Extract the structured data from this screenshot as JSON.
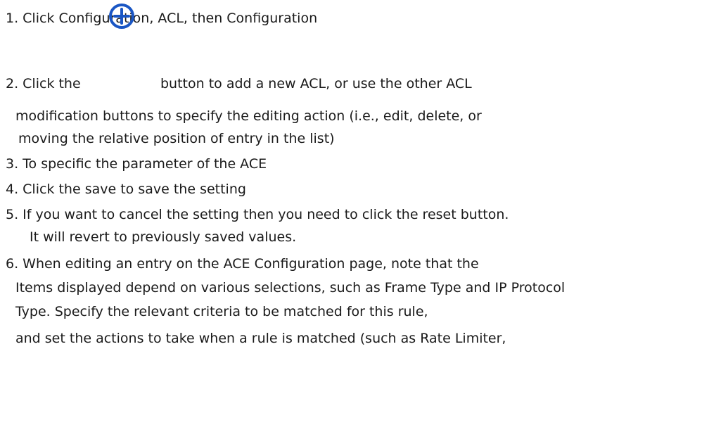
{
  "steps": {
    "s1": "1.   Click Configuration, ACL, then Configuration",
    "s2_a": "2.   Click the",
    "s2_b": "button to add a new ACL, or use the other ACL",
    "s2_c": "modification buttons to specify the editing action (i.e., edit, delete, or",
    "s2_d": "moving the relative position of entry in the list)",
    "s3": "3.   To specific the parameter of the ACE",
    "s4": "4.   Click the save to save the setting",
    "s5_a": "5.   If you want to cancel the setting then you need to click the reset button.",
    "s5_b": "It will revert to previously saved values.",
    "s6_a": "6. When editing an entry on the ACE Configuration page, note that the",
    "s6_b": "Items displayed depend on various selections, such as Frame Type and IP Protocol",
    "s6_c": "Type. Specify the relevant criteria to be matched for this rule,",
    "s6_d": "and set the actions to take when a rule is matched (such as Rate Limiter,"
  },
  "icons": {
    "add_icon_color": "#1a56c4"
  }
}
